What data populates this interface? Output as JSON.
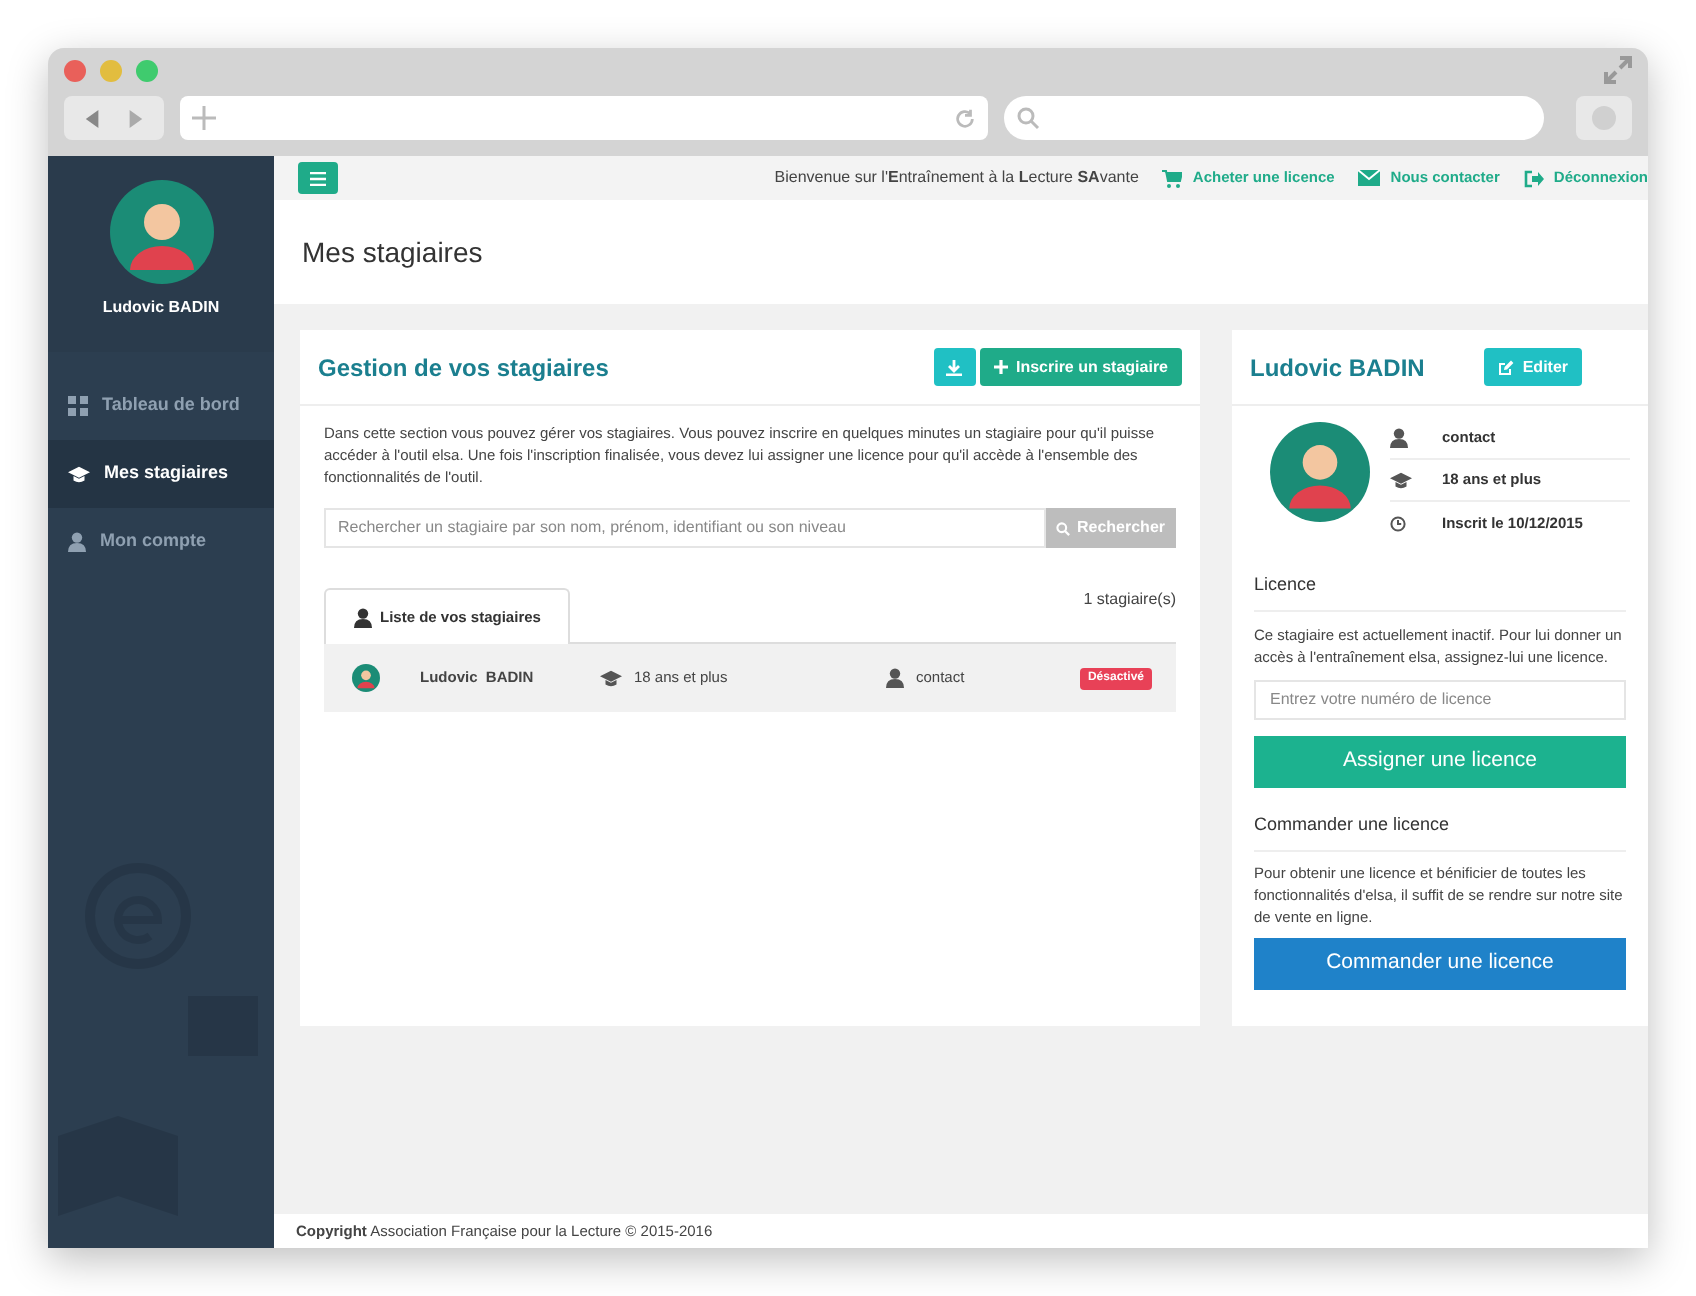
{
  "topbar": {
    "welcome": "Bienvenue sur l'**E**ntraînement à la **L**ecture **SA**vante",
    "links": [
      {
        "kind": "cart",
        "label": "Acheter une licence"
      },
      {
        "kind": "mail",
        "label": "Nous contacter"
      },
      {
        "kind": "logout",
        "label": "Déconnexion"
      }
    ]
  },
  "sidebar": {
    "user_name": "Ludovic BADIN",
    "items": [
      {
        "kind": "grid",
        "label": "Tableau de bord",
        "selected": false
      },
      {
        "kind": "cap",
        "label": "Mes stagiaires",
        "selected": true
      },
      {
        "kind": "user",
        "label": "Mon compte",
        "selected": false
      }
    ]
  },
  "page_title": "Mes stagiaires",
  "trainees": {
    "title": "Gestion de vos stagiaires",
    "add_button": "Inscrire un stagiaire",
    "description": "Dans cette section vous pouvez gérer vos stagiaires. Vous pouvez inscrire en quelques minutes un stagiaire pour qu'il puisse accéder à l'outil elsa. Une fois l'inscription finalisée, vous devez lui assigner une licence pour qu'il accède à l'ensemble des fonctionnalités de l'outil.",
    "search": {
      "placeholder": "Rechercher un stagiaire par son nom, prénom, identifiant ou son niveau",
      "button": "Rechercher"
    },
    "tabs": [
      {
        "label": "Liste de vos stagiaires",
        "selected": true
      }
    ],
    "count": "1 stagiaire(s)",
    "rows": [
      {
        "first_name": "Ludovic",
        "last_name": "BADIN",
        "level": "18 ans et plus",
        "contact": "contact",
        "status": "Désactivé",
        "active": false
      }
    ]
  },
  "profile": {
    "name": "Ludovic BADIN",
    "edit_button": "Editer",
    "details": [
      {
        "kind": "user",
        "text": "contact"
      },
      {
        "kind": "cap",
        "text": "18 ans et plus"
      },
      {
        "kind": "clock",
        "text": "Inscrit le 10/12/2015"
      }
    ],
    "licence": {
      "title": "Licence",
      "text": "Ce stagiaire est actuellement inactif. Pour lui donner un accès à l'entraînement elsa, assignez-lui une licence.",
      "placeholder": "Entrez votre numéro de licence",
      "button": "Assigner une licence"
    },
    "order": {
      "title": "Commander une licence",
      "text": "Pour obtenir une licence et bénificier de toutes les fonctionnalités d'elsa, il suffit de se rendre sur notre site de vente en ligne.",
      "button": "Commander une licence"
    }
  },
  "footer": "**Copyright** Association Française pour la Lecture © 2015-2016"
}
